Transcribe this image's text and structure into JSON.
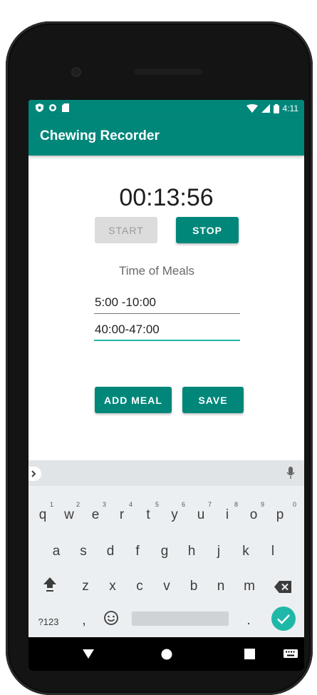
{
  "status_bar": {
    "time": "4:11",
    "left_icons": [
      "shield-icon",
      "circle-icon",
      "sd-card-icon"
    ],
    "right_icons": [
      "wifi-icon",
      "signal-icon",
      "battery-icon"
    ]
  },
  "app_bar": {
    "title": "Chewing Recorder"
  },
  "timer": {
    "value": "00:13:56"
  },
  "buttons": {
    "start": "START",
    "stop": "STOP",
    "add_meal": "ADD MEAL",
    "save": "SAVE"
  },
  "meals": {
    "title": "Time of Meals",
    "entries": [
      "5:00 -10:00",
      "40:00-47:00"
    ]
  },
  "keyboard": {
    "row1": [
      "q",
      "w",
      "e",
      "r",
      "t",
      "y",
      "u",
      "i",
      "o",
      "p"
    ],
    "row1_numbers": [
      "1",
      "2",
      "3",
      "4",
      "5",
      "6",
      "7",
      "8",
      "9",
      "0"
    ],
    "row2": [
      "a",
      "s",
      "d",
      "f",
      "g",
      "h",
      "j",
      "k",
      "l"
    ],
    "row3": [
      "z",
      "x",
      "c",
      "v",
      "b",
      "n",
      "m"
    ],
    "symbols_key": "?123",
    "comma": ",",
    "period": "."
  },
  "colors": {
    "primary": "#00877a",
    "accent": "#1fb8a8"
  }
}
